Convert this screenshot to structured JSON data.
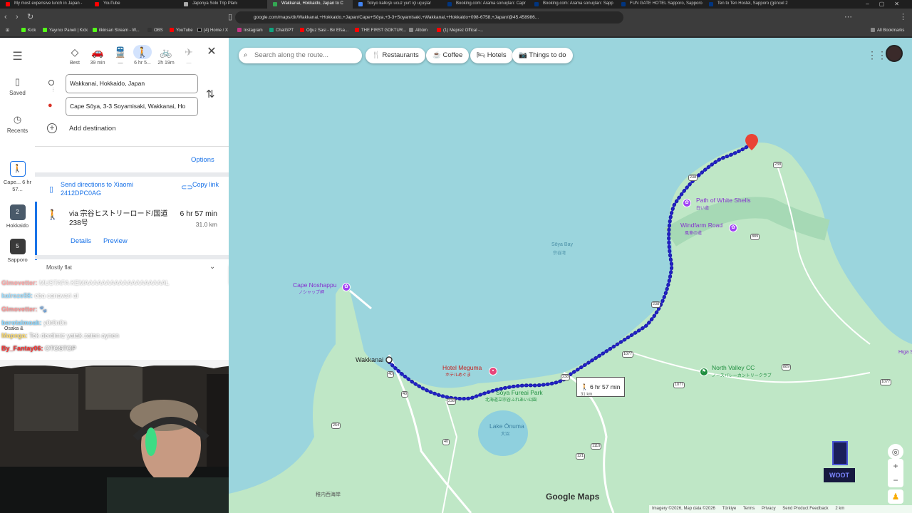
{
  "browser": {
    "tabs": [
      {
        "title": "My most expensive lunch in Japan -",
        "color": "#ff0000"
      },
      {
        "title": "YouTube",
        "color": "#ff0000"
      },
      {
        "title": "Japonya Solo Trip Planı",
        "color": "#aaaaaa"
      },
      {
        "title": "Wakkanai, Hokkaido, Japan to C",
        "color": "#34a853",
        "active": true
      },
      {
        "title": "Tokyo kalkışlı ucuz yurt içi uçuşlar",
        "color": "#4285f4"
      },
      {
        "title": "Booking.com: Arama sonuçları: Capr",
        "color": "#003580"
      },
      {
        "title": "Booking.com: Arama sonuçları: Sapp",
        "color": "#003580"
      },
      {
        "title": "FUN GATE HOTEL Sapporo, Sapporo",
        "color": "#003580"
      },
      {
        "title": "Ten to Ten Hostel, Sapporo (güncel 2",
        "color": "#003580"
      }
    ],
    "url": "google.com/maps/dir/Wakkanai,+Hokkaido,+Japan/Cape+Sōya,+3-3+Soyamisaki,+Wakkanai,+Hokkaido+098-6758,+Japan/@45.458986...",
    "bookmarks": [
      {
        "label": "Kick",
        "color": "#53fc18"
      },
      {
        "label": "Yayıncı Paneli | Kick",
        "color": "#53fc18"
      },
      {
        "label": "ilkinsan Stream - W...",
        "color": "#53fc18"
      },
      {
        "label": "OBS",
        "color": "#333333"
      },
      {
        "label": "YouTube",
        "color": "#ff0000"
      },
      {
        "label": "(4) Home / X",
        "color": "#000000"
      },
      {
        "label": "Instagram",
        "color": "#c13584"
      },
      {
        "label": "ChatGPT",
        "color": "#10a37f"
      },
      {
        "label": "Oğuz Sasi - Bir Efsa...",
        "color": "#ff0000"
      },
      {
        "label": "THE FIRST GOKTUR...",
        "color": "#ff0000"
      },
      {
        "label": "Albüm",
        "color": "#888888"
      },
      {
        "label": "(1) Meprez Offical -...",
        "color": "#ff0000"
      }
    ],
    "all_bookmarks": "All Bookmarks"
  },
  "rail": {
    "saved": "Saved",
    "recents": "Recents",
    "recent_places": [
      {
        "label": "Cape... 6 hr 57...",
        "badge": ""
      },
      {
        "label": "Hokkaido",
        "badge": "2"
      },
      {
        "label": "Sapporo",
        "badge": "5"
      },
      {
        "label": "Osaka &",
        "badge": ""
      }
    ]
  },
  "directions": {
    "modes": [
      {
        "name": "best",
        "icon": "◇",
        "label": "Best"
      },
      {
        "name": "driving",
        "icon": "🚗",
        "label": "39 min"
      },
      {
        "name": "transit",
        "icon": "🚆",
        "label": "—"
      },
      {
        "name": "walking",
        "icon": "🚶",
        "label": "6 hr 5...",
        "selected": true
      },
      {
        "name": "cycling",
        "icon": "🚲",
        "label": "2h 19m"
      },
      {
        "name": "flights",
        "icon": "✈",
        "label": "—"
      }
    ],
    "origin": "Wakkanai, Hokkaido, Japan",
    "destination": "Cape Sōya, 3-3 Soyamisaki, Wakkanai, Ho",
    "add_destination": "Add destination",
    "options": "Options",
    "send_directions": "Send directions to Xiaomi 2412DPC0AG",
    "copy_link": "Copy link",
    "route": {
      "via": "via 宗谷ヒストリーロード/国道238号",
      "duration": "6 hr 57 min",
      "distance": "31.0 km",
      "details": "Details",
      "preview": "Preview"
    },
    "terrain": "Mostly flat"
  },
  "chat": [
    {
      "user": "Glmovetter:",
      "msg": "MUSTAFA KEMAAAAAAAAAAAAAAAAAAAL",
      "color": "#ff5e5e"
    },
    {
      "user": "kairoze58:",
      "msg": "eba canavari al",
      "color": "#5ac8ff"
    },
    {
      "user": "Glmovetter:",
      "msg": "🐾",
      "color": "#ff5e5e"
    },
    {
      "user": "berotalmoak:",
      "msg": "y0r0n0n",
      "color": "#5ac8ff"
    },
    {
      "user": "Mapega:",
      "msg": "Tek derdimiz yatak zaten aynen",
      "color": "#ffd23f"
    },
    {
      "user": "By_Fantay06:",
      "msg": "OTOSTOP",
      "color": "#ff3030"
    }
  ],
  "map": {
    "search_placeholder": "Search along the route...",
    "chips": [
      "Restaurants",
      "Coffee",
      "Hotels",
      "Things to do"
    ],
    "labels": {
      "path_white_shells": "Path of White Shells",
      "path_white_shells_jp": "白い道",
      "windfarm_road": "Windfarm Road",
      "windfarm_road_jp": "風車の道",
      "soya_bay": "Sōya Bay",
      "soya_bay_jp": "宗谷湾",
      "cape_noshappu": "Cape Noshappu",
      "cape_noshappu_jp": "ノシャップ岬",
      "wakkanai": "Wakkanai",
      "hotel_meguma": "Hotel Meguma",
      "hotel_meguma_jp": "ホテルめぐま",
      "soya_fureai_park": "Sōya Fureai Park",
      "soya_fureai_park_jp": "北海道立宗谷ふれあい公園",
      "lake_onuma": "Lake Ōnuma",
      "lake_onuma_jp": "大沼",
      "north_valley_cc": "North Valley CC",
      "north_valley_cc_jp": "ノースバレーカントリークラブ",
      "higashi": "Higa Shir",
      "port": "稚内西海岸"
    },
    "route_callout": {
      "duration": "6 hr 57 min",
      "distance": "31 km"
    },
    "roads": [
      "238",
      "238",
      "238",
      "238",
      "238",
      "1077",
      "1077",
      "1077",
      "889",
      "889",
      "254",
      "40",
      "40",
      "40",
      "121",
      "1119",
      "1077"
    ],
    "brand": "Google Maps",
    "footer": [
      "Imagery ©2026, Map data ©2026",
      "Türkiye",
      "Terms",
      "Privacy",
      "Send Product Feedback",
      "2 km"
    ]
  },
  "overlay_logo": "WOOT"
}
